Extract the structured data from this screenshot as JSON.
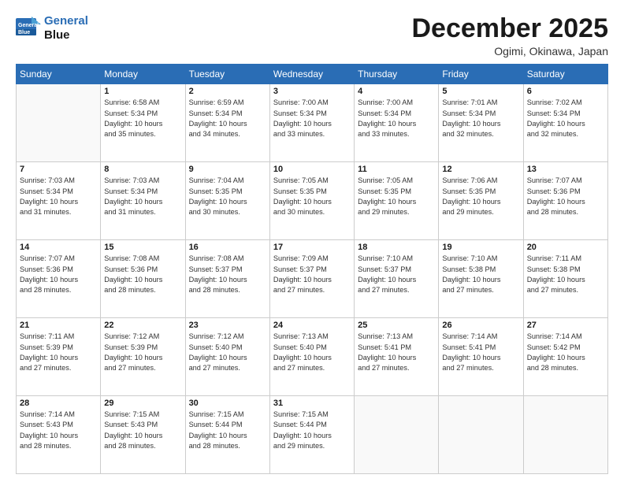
{
  "header": {
    "logo_line1": "General",
    "logo_line2": "Blue",
    "month": "December 2025",
    "location": "Ogimi, Okinawa, Japan"
  },
  "weekdays": [
    "Sunday",
    "Monday",
    "Tuesday",
    "Wednesday",
    "Thursday",
    "Friday",
    "Saturday"
  ],
  "weeks": [
    [
      {
        "day": "",
        "info": ""
      },
      {
        "day": "1",
        "info": "Sunrise: 6:58 AM\nSunset: 5:34 PM\nDaylight: 10 hours\nand 35 minutes."
      },
      {
        "day": "2",
        "info": "Sunrise: 6:59 AM\nSunset: 5:34 PM\nDaylight: 10 hours\nand 34 minutes."
      },
      {
        "day": "3",
        "info": "Sunrise: 7:00 AM\nSunset: 5:34 PM\nDaylight: 10 hours\nand 33 minutes."
      },
      {
        "day": "4",
        "info": "Sunrise: 7:00 AM\nSunset: 5:34 PM\nDaylight: 10 hours\nand 33 minutes."
      },
      {
        "day": "5",
        "info": "Sunrise: 7:01 AM\nSunset: 5:34 PM\nDaylight: 10 hours\nand 32 minutes."
      },
      {
        "day": "6",
        "info": "Sunrise: 7:02 AM\nSunset: 5:34 PM\nDaylight: 10 hours\nand 32 minutes."
      }
    ],
    [
      {
        "day": "7",
        "info": "Sunrise: 7:03 AM\nSunset: 5:34 PM\nDaylight: 10 hours\nand 31 minutes."
      },
      {
        "day": "8",
        "info": "Sunrise: 7:03 AM\nSunset: 5:34 PM\nDaylight: 10 hours\nand 31 minutes."
      },
      {
        "day": "9",
        "info": "Sunrise: 7:04 AM\nSunset: 5:35 PM\nDaylight: 10 hours\nand 30 minutes."
      },
      {
        "day": "10",
        "info": "Sunrise: 7:05 AM\nSunset: 5:35 PM\nDaylight: 10 hours\nand 30 minutes."
      },
      {
        "day": "11",
        "info": "Sunrise: 7:05 AM\nSunset: 5:35 PM\nDaylight: 10 hours\nand 29 minutes."
      },
      {
        "day": "12",
        "info": "Sunrise: 7:06 AM\nSunset: 5:35 PM\nDaylight: 10 hours\nand 29 minutes."
      },
      {
        "day": "13",
        "info": "Sunrise: 7:07 AM\nSunset: 5:36 PM\nDaylight: 10 hours\nand 28 minutes."
      }
    ],
    [
      {
        "day": "14",
        "info": "Sunrise: 7:07 AM\nSunset: 5:36 PM\nDaylight: 10 hours\nand 28 minutes."
      },
      {
        "day": "15",
        "info": "Sunrise: 7:08 AM\nSunset: 5:36 PM\nDaylight: 10 hours\nand 28 minutes."
      },
      {
        "day": "16",
        "info": "Sunrise: 7:08 AM\nSunset: 5:37 PM\nDaylight: 10 hours\nand 28 minutes."
      },
      {
        "day": "17",
        "info": "Sunrise: 7:09 AM\nSunset: 5:37 PM\nDaylight: 10 hours\nand 27 minutes."
      },
      {
        "day": "18",
        "info": "Sunrise: 7:10 AM\nSunset: 5:37 PM\nDaylight: 10 hours\nand 27 minutes."
      },
      {
        "day": "19",
        "info": "Sunrise: 7:10 AM\nSunset: 5:38 PM\nDaylight: 10 hours\nand 27 minutes."
      },
      {
        "day": "20",
        "info": "Sunrise: 7:11 AM\nSunset: 5:38 PM\nDaylight: 10 hours\nand 27 minutes."
      }
    ],
    [
      {
        "day": "21",
        "info": "Sunrise: 7:11 AM\nSunset: 5:39 PM\nDaylight: 10 hours\nand 27 minutes."
      },
      {
        "day": "22",
        "info": "Sunrise: 7:12 AM\nSunset: 5:39 PM\nDaylight: 10 hours\nand 27 minutes."
      },
      {
        "day": "23",
        "info": "Sunrise: 7:12 AM\nSunset: 5:40 PM\nDaylight: 10 hours\nand 27 minutes."
      },
      {
        "day": "24",
        "info": "Sunrise: 7:13 AM\nSunset: 5:40 PM\nDaylight: 10 hours\nand 27 minutes."
      },
      {
        "day": "25",
        "info": "Sunrise: 7:13 AM\nSunset: 5:41 PM\nDaylight: 10 hours\nand 27 minutes."
      },
      {
        "day": "26",
        "info": "Sunrise: 7:14 AM\nSunset: 5:41 PM\nDaylight: 10 hours\nand 27 minutes."
      },
      {
        "day": "27",
        "info": "Sunrise: 7:14 AM\nSunset: 5:42 PM\nDaylight: 10 hours\nand 28 minutes."
      }
    ],
    [
      {
        "day": "28",
        "info": "Sunrise: 7:14 AM\nSunset: 5:43 PM\nDaylight: 10 hours\nand 28 minutes."
      },
      {
        "day": "29",
        "info": "Sunrise: 7:15 AM\nSunset: 5:43 PM\nDaylight: 10 hours\nand 28 minutes."
      },
      {
        "day": "30",
        "info": "Sunrise: 7:15 AM\nSunset: 5:44 PM\nDaylight: 10 hours\nand 28 minutes."
      },
      {
        "day": "31",
        "info": "Sunrise: 7:15 AM\nSunset: 5:44 PM\nDaylight: 10 hours\nand 29 minutes."
      },
      {
        "day": "",
        "info": ""
      },
      {
        "day": "",
        "info": ""
      },
      {
        "day": "",
        "info": ""
      }
    ]
  ]
}
